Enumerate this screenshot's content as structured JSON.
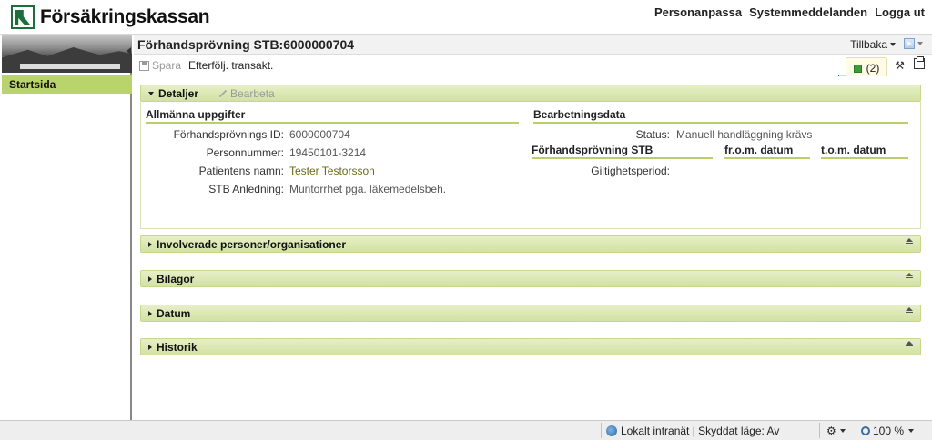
{
  "header": {
    "brand": "Försäkringskassan",
    "links": [
      "Personanpassa",
      "Systemmeddelanden",
      "Logga ut"
    ]
  },
  "sidebar": {
    "items": [
      {
        "label": "Startsida"
      }
    ]
  },
  "titlebar": {
    "title": "Förhandsprövning STB:6000000704",
    "back_label": "Tillbaka"
  },
  "toolbar": {
    "save_label": "Spara",
    "followup_label": "Efterfölj. transakt.",
    "messages_count": "(2)"
  },
  "details": {
    "title": "Detaljer",
    "edit_label": "Bearbeta",
    "general": {
      "heading": "Allmänna uppgifter",
      "fields": [
        {
          "label": "Förhandsprövnings ID:",
          "value": "6000000704"
        },
        {
          "label": "Personnummer:",
          "value": "19450101-3214"
        },
        {
          "label": "Patientens namn:",
          "value": "Tester Testorsson"
        },
        {
          "label": "STB Anledning:",
          "value": "Muntorrhet pga. läkemedelsbeh."
        }
      ]
    },
    "processing": {
      "heading": "Bearbetningsdata",
      "status_label": "Status:",
      "status_value": "Manuell handläggning krävs",
      "table_headers": [
        "Förhandsprövning STB",
        "fr.o.m. datum",
        "t.o.m. datum"
      ],
      "validity_label": "Giltighetsperiod:"
    }
  },
  "sections": [
    {
      "title": "Involverade personer/organisationer"
    },
    {
      "title": "Bilagor"
    },
    {
      "title": "Datum"
    },
    {
      "title": "Historik"
    }
  ],
  "statusbar": {
    "zone": "Lokalt intranät | Skyddat läge: Av",
    "zoom": "100 %"
  }
}
